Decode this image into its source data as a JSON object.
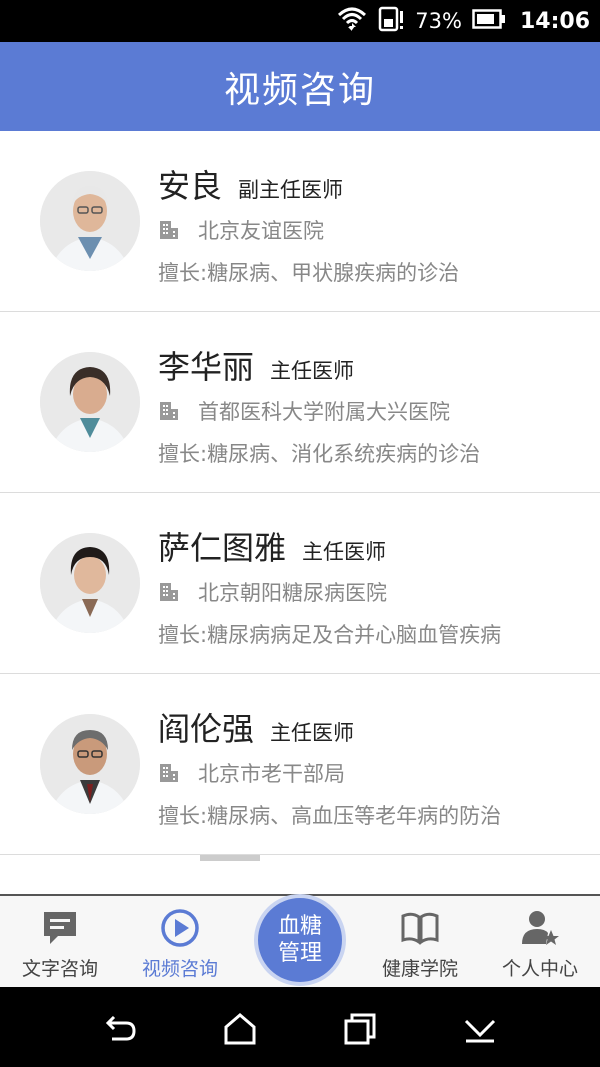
{
  "status_bar": {
    "battery_percent": "73%",
    "time": "14:06"
  },
  "header": {
    "title": "视频咨询"
  },
  "doctors": [
    {
      "name": "安良",
      "title": "副主任医师",
      "hospital": "北京友谊医院",
      "specialty": "擅长:糖尿病、甲状腺疾病的诊治"
    },
    {
      "name": "李华丽",
      "title": "主任医师",
      "hospital": "首都医科大学附属大兴医院",
      "specialty": "擅长:糖尿病、消化系统疾病的诊治"
    },
    {
      "name": "萨仁图雅",
      "title": "主任医师",
      "hospital": "北京朝阳糖尿病医院",
      "specialty": "擅长:糖尿病病足及合并心脑血管疾病"
    },
    {
      "name": "阎伦强",
      "title": "主任医师",
      "hospital": "北京市老干部局",
      "specialty": "擅长:糖尿病、高血压等老年病的防治"
    }
  ],
  "tabbar": {
    "text_consult": "文字咨询",
    "video_consult": "视频咨询",
    "center_line1": "血糖",
    "center_line2": "管理",
    "health_academy": "健康学院",
    "personal_center": "个人中心"
  },
  "colors": {
    "brand": "#5b7bd4",
    "inactive_tab": "#666666",
    "secondary_text": "#888888"
  },
  "icons": [
    "wifi-icon",
    "sim-icon",
    "battery-icon",
    "hospital-icon",
    "chat-icon",
    "play-icon",
    "book-icon",
    "user-star-icon",
    "back-icon",
    "home-icon",
    "recents-icon",
    "menu-down-icon"
  ]
}
